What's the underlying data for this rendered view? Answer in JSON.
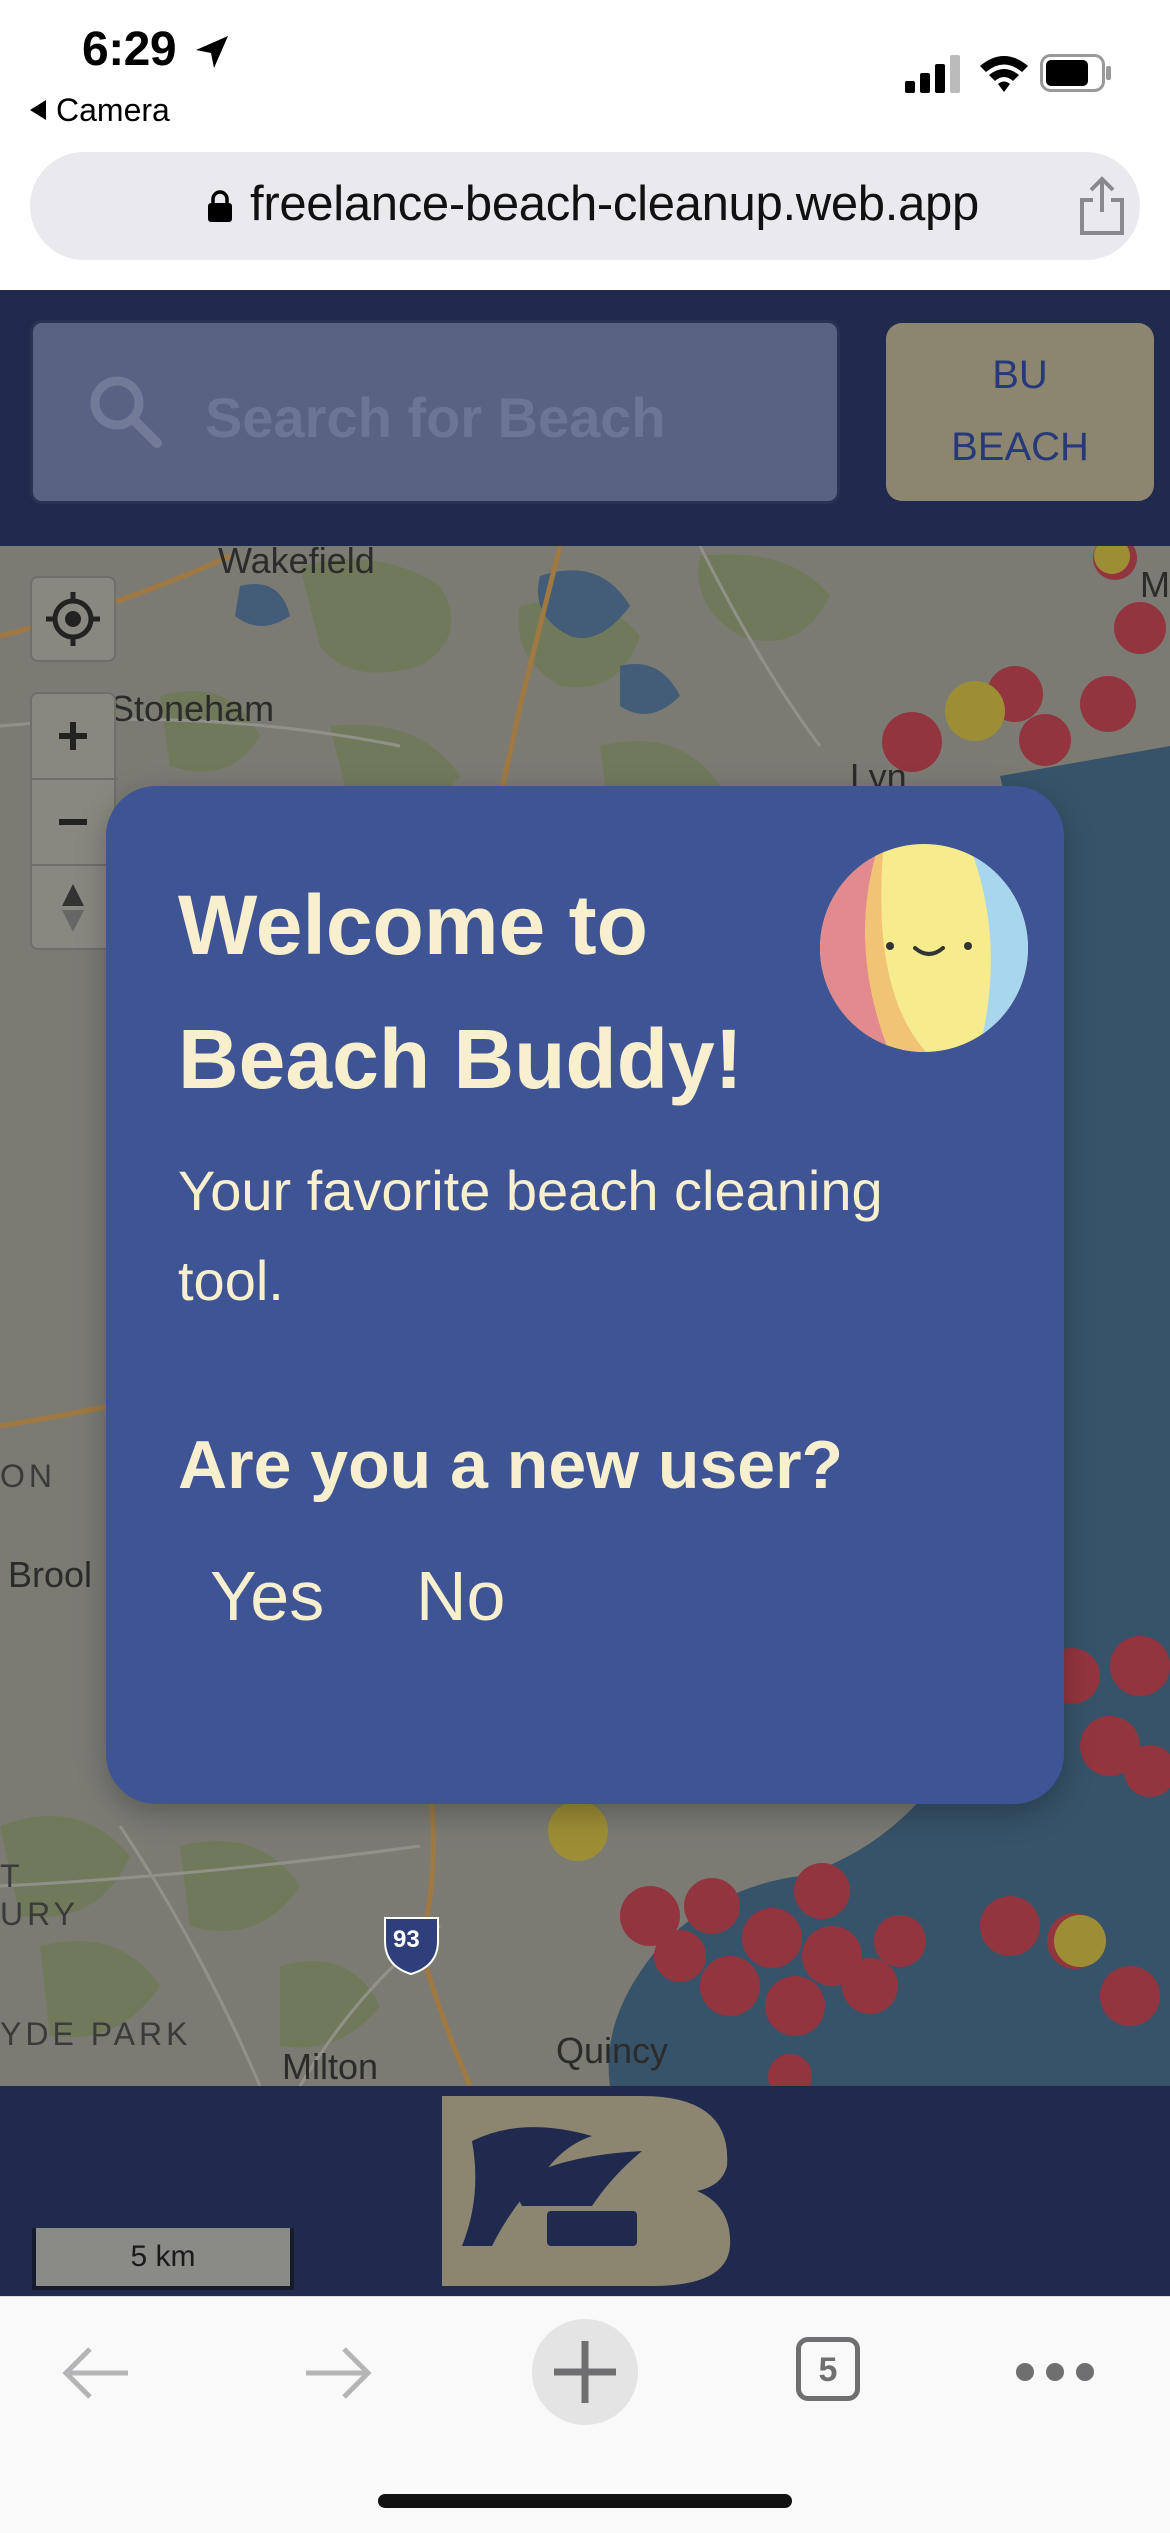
{
  "status_bar": {
    "time": "6:29",
    "back_app": "Camera"
  },
  "browser": {
    "url": "freelance-beach-cleanup.web.app",
    "tab_count": "5"
  },
  "header": {
    "search_placeholder": "Search for Beach",
    "bu_button_line1": "BU",
    "bu_button_line2": "BEACH"
  },
  "map": {
    "labels": {
      "wakefield": "Wakefield",
      "stoneham": "Stoneham",
      "brook": "Brool",
      "hyde_park": "YDE PARK",
      "milton": "Milton",
      "quincy": "Quincy",
      "on": "ON",
      "ury": "URY",
      "t": "T",
      "highway": "93",
      "m_right": "M",
      "lyn": "Lyn"
    },
    "scale": "5 km"
  },
  "modal": {
    "title": "Welcome to Beach Buddy!",
    "subtitle": "Your favorite beach cleaning tool.",
    "question": "Are you a new user?",
    "yes": "Yes",
    "no": "No"
  },
  "colors": {
    "header_bg": "#1f2a4e",
    "modal_bg": "#3e5495",
    "modal_text": "#f7efce",
    "accent_tan": "#8c8670"
  }
}
